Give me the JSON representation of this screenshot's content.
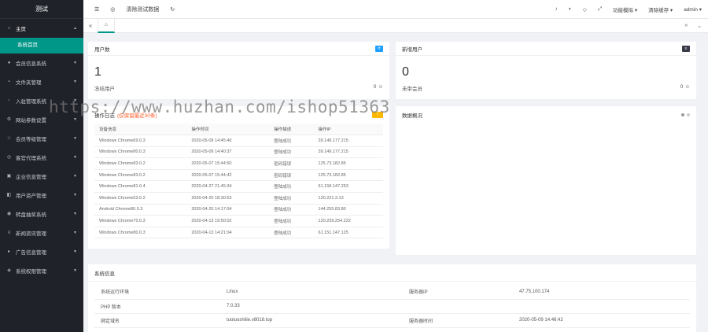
{
  "app": {
    "title": "测试"
  },
  "sidebar": {
    "home_label": "主页",
    "home_sub": "系统首页",
    "items": [
      {
        "label": "会员信息系统",
        "icon": "users-icon"
      },
      {
        "label": "文件夹管理",
        "icon": "folder-icon"
      },
      {
        "label": "入驻管理系统",
        "icon": "doc-icon"
      },
      {
        "label": "网站参数设置",
        "icon": "gear-icon"
      },
      {
        "label": "会员等级管理",
        "icon": "star-icon"
      },
      {
        "label": "客官代理系统",
        "icon": "agent-icon"
      },
      {
        "label": "企业信息管理",
        "icon": "building-icon"
      },
      {
        "label": "用户资产管理",
        "icon": "wallet-icon"
      },
      {
        "label": "转盘抽奖系统",
        "icon": "wheel-icon"
      },
      {
        "label": "新闻资讯管理",
        "icon": "news-icon"
      },
      {
        "label": "广告信息管理",
        "icon": "ad-icon"
      },
      {
        "label": "系统权限管理",
        "icon": "shield-icon"
      }
    ]
  },
  "topbar": {
    "clear_label": "清除测试数据",
    "function_label": "功能模拟",
    "cache_label": "清除缓存",
    "user_label": "admin"
  },
  "cards": {
    "users": {
      "title": "用户数",
      "count": "1",
      "caption": "冻结用户",
      "right": "0"
    },
    "new_users": {
      "title": "新增用户",
      "count": "0",
      "caption": "未审会员",
      "right": "0"
    },
    "login": {
      "title": "操作日志",
      "warn": "(仅保留最近30条)",
      "columns": [
        "设备信息",
        "操作时间",
        "操作描述",
        "操作IP"
      ],
      "rows": [
        [
          "Windows Chrome69.0.3",
          "2020-05-09 14:45:40",
          "登陆成功",
          "39.149.177.215"
        ],
        [
          "Windows Chrome80.0.3",
          "2020-05-09 14:40:37",
          "登陆成功",
          "39.149.177.215"
        ],
        [
          "Windows Chrome83.0.2",
          "2020-05-07 15:44:50",
          "密码错误",
          "125.73.182.85"
        ],
        [
          "Windows Chrome83.0.2",
          "2020-05-07 15:44:42",
          "密码错误",
          "125.73.182.85"
        ],
        [
          "Windows Chrome81.0.4",
          "2020-04-27 21:45:34",
          "登陆成功",
          "61.158.147.253"
        ],
        [
          "Windows Chrome53.0.2",
          "2020-04-20 18:30:53",
          "登陆成功",
          "120.221.3.13"
        ],
        [
          "Android Chrome80.0.3",
          "2020-04-20 14:17:04",
          "登陆成功",
          "144.255.83.80"
        ],
        [
          "Windows Chrome70.0.3",
          "2020-04-13 19:50:02",
          "登陆成功",
          "120.239.254.222"
        ],
        [
          "Windows Chrome80.0.3",
          "2020-04-13 14:21:04",
          "登陆成功",
          "61.151.147.125"
        ]
      ]
    },
    "stats": {
      "title": "数据概况"
    },
    "sys": {
      "title": "系统信息",
      "rows": [
        {
          "k1": "系统运行环境",
          "v1": "Linux",
          "k2": "服务器IP",
          "v2": "47.75.100.174"
        },
        {
          "k1": "PHP 版本",
          "v1": "7.0.33",
          "k2": "",
          "v2": ""
        },
        {
          "k1": "绑定域名",
          "v1": "tuoluoshilie.v8018.top",
          "k2": "服务器时间",
          "v2": "2020-05-09 14:46:42"
        }
      ]
    }
  },
  "watermark": "https://www.huzhan.com/ishop51363",
  "colors": {
    "accent": "#009688",
    "sidebar": "#20222a",
    "blue_badge": "#1e9fff",
    "dark_badge": "#393d49",
    "warn": "#ff5722"
  }
}
